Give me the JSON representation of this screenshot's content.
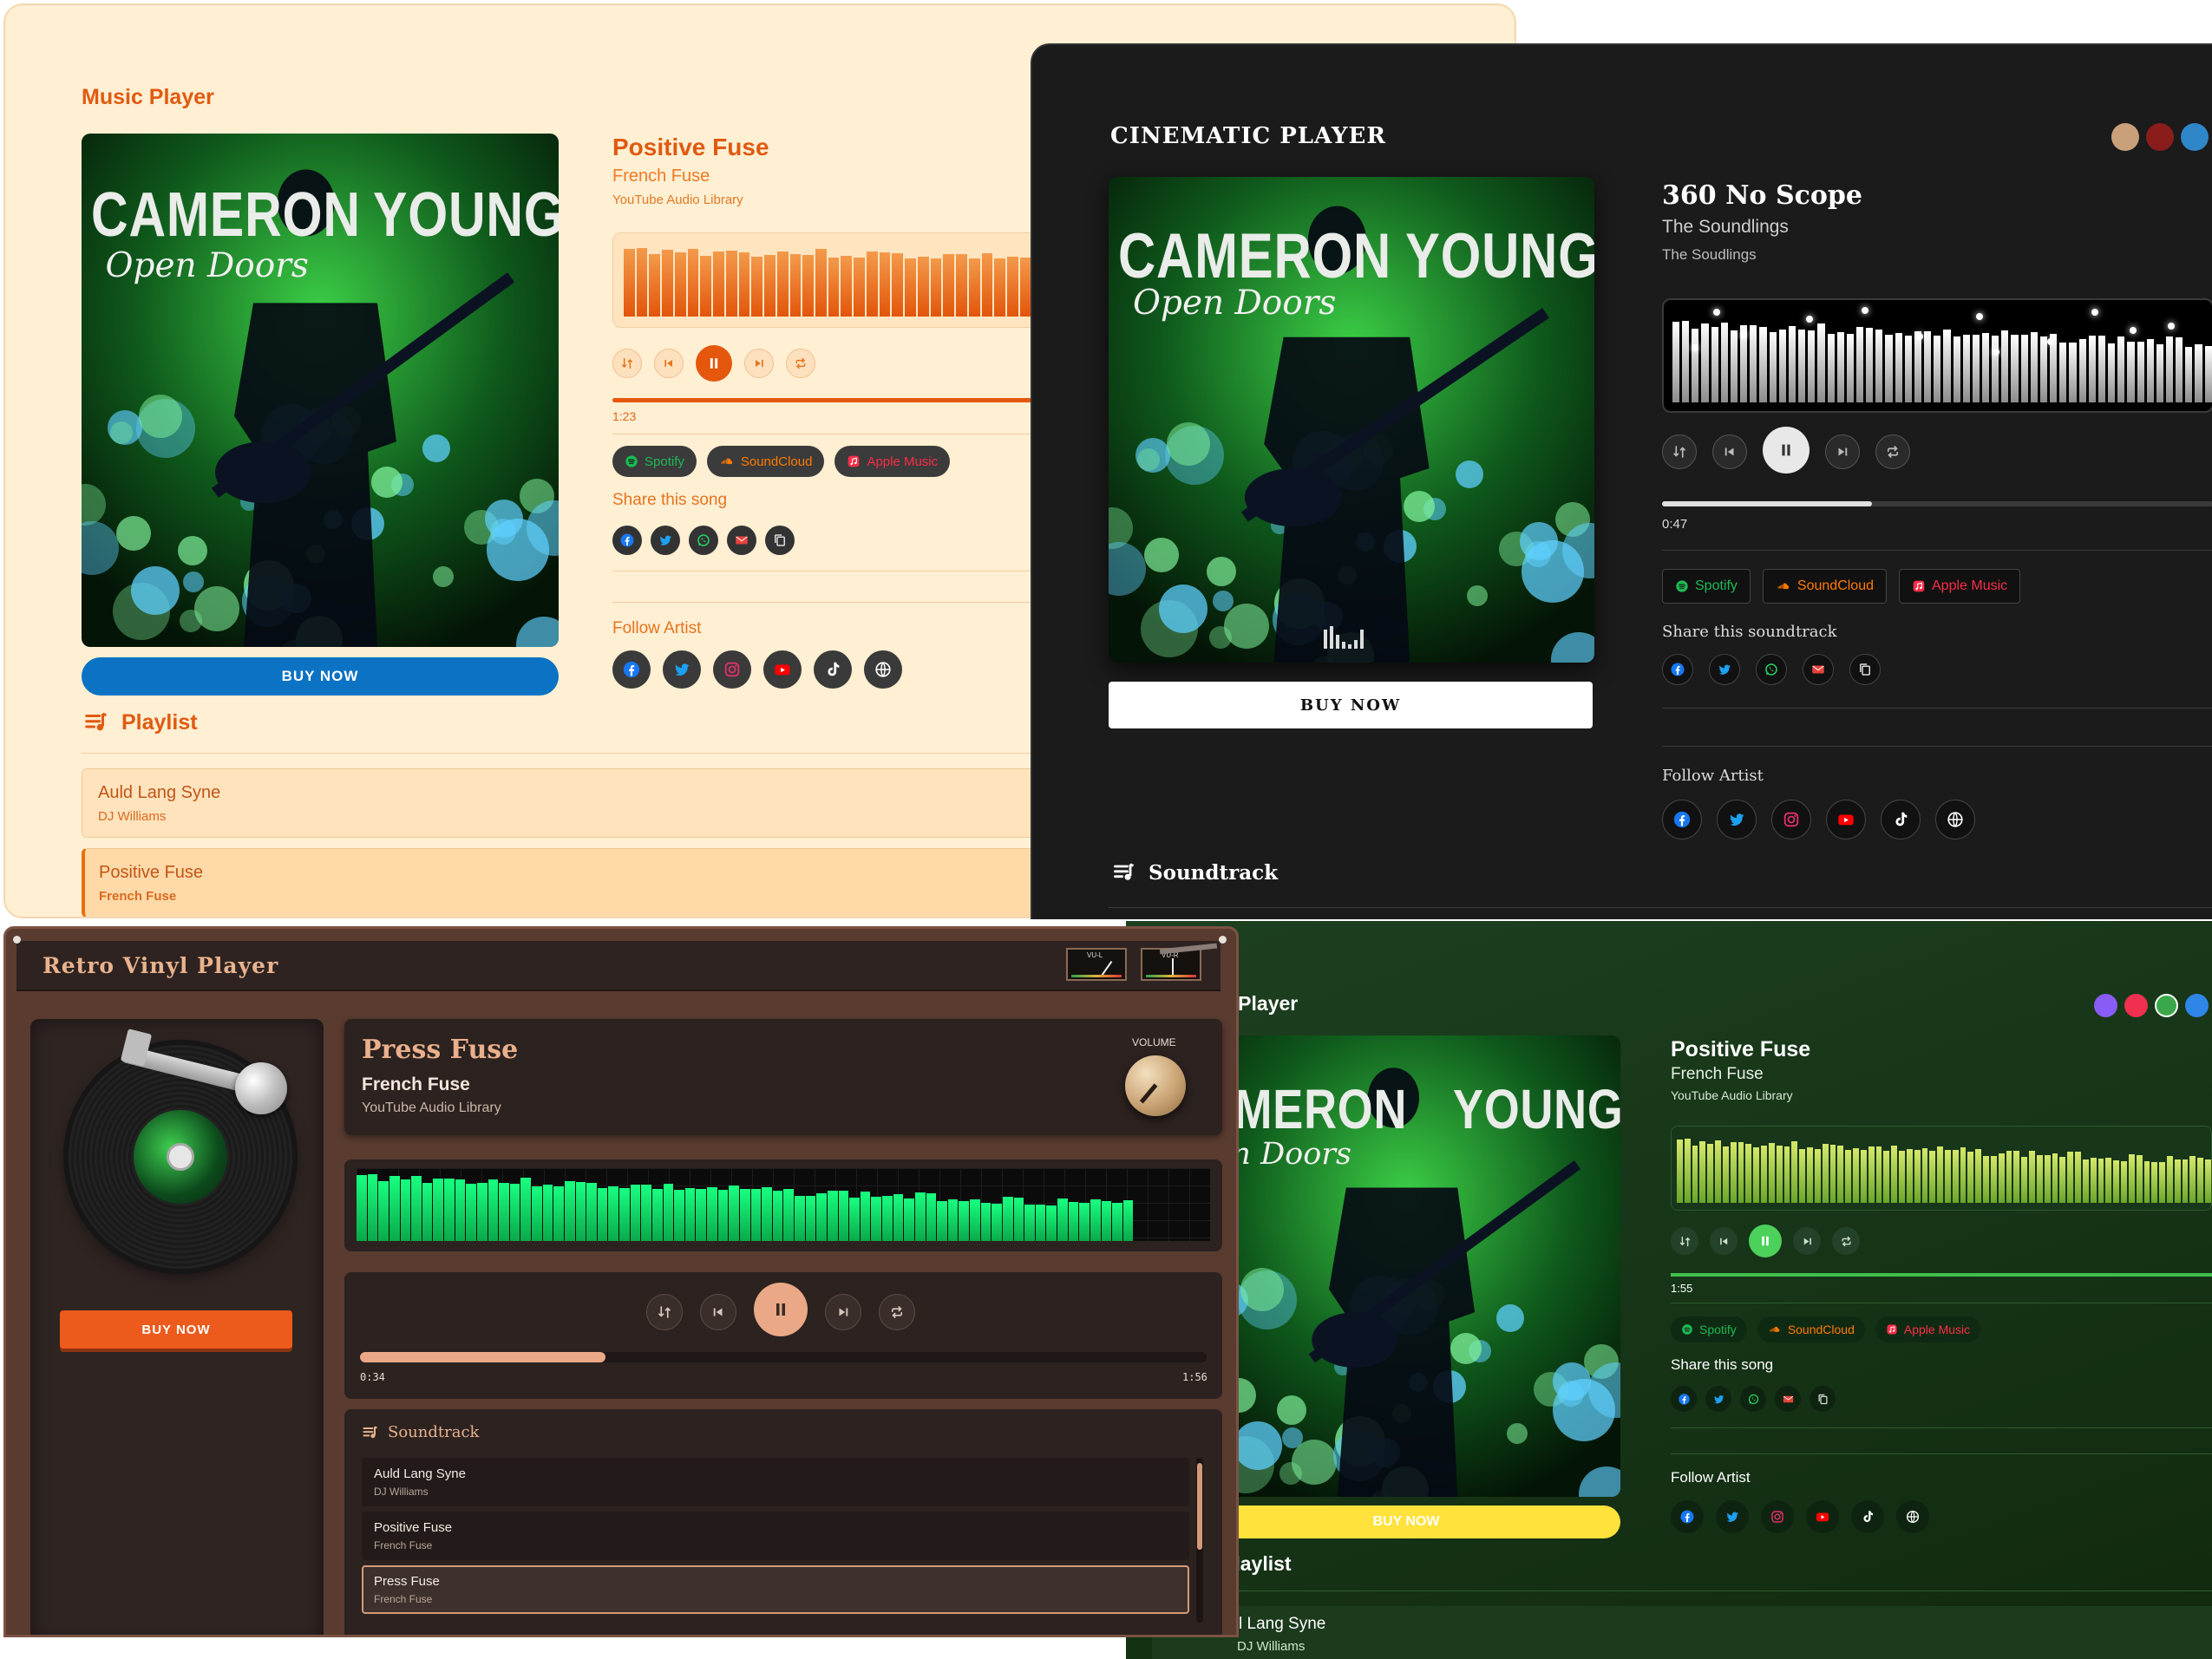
{
  "light_player": {
    "header": "Music Player",
    "title": "Positive Fuse",
    "artist": "French Fuse",
    "source": "YouTube Audio Library",
    "time": "1:23",
    "progress": 0.78,
    "buy_label": "BUY NOW",
    "platforms": [
      "Spotify",
      "SoundCloud",
      "Apple Music"
    ],
    "share_label": "Share this song",
    "follow_label": "Follow Artist",
    "playlist_title": "Playlist",
    "playlist": [
      {
        "title": "Auld Lang Syne",
        "artist": "DJ Williams"
      },
      {
        "title": "Positive Fuse",
        "artist": "French Fuse"
      }
    ],
    "cover": {
      "artist_left": "CAMERON",
      "artist_right": "YOUNG",
      "album": "Open Doors"
    }
  },
  "cinematic_player": {
    "header": "CINEMATIC PLAYER",
    "title": "360 No Scope",
    "artist": "The Soundlings",
    "source": "The Soudlings",
    "time": "0:47",
    "progress": 0.38,
    "buy_label": "BUY NOW",
    "platforms": [
      "Spotify",
      "SoundCloud",
      "Apple Music"
    ],
    "share_label": "Share this soundtrack",
    "follow_label": "Follow Artist",
    "playlist_title": "Soundtrack",
    "theme_dots": [
      "#c9a07a",
      "#8b1c1c",
      "#2f86c9"
    ],
    "cover": {
      "artist_left": "CAMERON",
      "artist_right": "YOUNG",
      "album": "Open Doors"
    }
  },
  "retro_player": {
    "header": "Retro Vinyl Player",
    "vu_left": "VU-L",
    "vu_right": "VU-R",
    "title": "Press Fuse",
    "artist": "French Fuse",
    "source": "YouTube Audio Library",
    "volume_label": "VOLUME",
    "time_current": "0:34",
    "time_total": "1:56",
    "progress": 0.29,
    "buy_label": "BUY NOW",
    "playlist_title": "Soundtrack",
    "playlist": [
      {
        "title": "Auld Lang Syne",
        "artist": "DJ Williams"
      },
      {
        "title": "Positive Fuse",
        "artist": "French Fuse"
      },
      {
        "title": "Press Fuse",
        "artist": "French Fuse"
      }
    ]
  },
  "green_player": {
    "header": "c Player",
    "title": "Positive Fuse",
    "artist": "French Fuse",
    "source": "YouTube Audio Library",
    "time": "1:55",
    "progress": 1.0,
    "buy_label": "BUY NOW",
    "platforms": [
      "Spotify",
      "SoundCloud",
      "Apple Music"
    ],
    "share_label": "Share this song",
    "follow_label": "Follow Artist",
    "playlist_title": "Playlist",
    "playlist": [
      {
        "title": "l Lang Syne",
        "artist": "DJ Williams"
      }
    ],
    "theme_dots": [
      "#8a5cf6",
      "#f0304f",
      "#3aa84a",
      "#2f86e9"
    ],
    "cover": {
      "artist_left": "AMERON",
      "artist_right": "YOUNG",
      "album": "en Doors"
    }
  },
  "colors": {
    "light_accent": "#e85d10",
    "light_bg": "#fff0d4",
    "blue_button": "#0b72c4",
    "cine_bg": "#1b1b1b",
    "retro_bg": "#3c2a24",
    "retro_accent": "#e8a47c",
    "green_bg": "#16341a",
    "green_accent": "#4cd15a",
    "spotify": "#1db954",
    "soundcloud": "#ff7a00",
    "apple_music": "#fa2d48"
  },
  "icons": [
    "shuffle-icon",
    "previous-icon",
    "pause-icon",
    "next-icon",
    "repeat-icon",
    "facebook-icon",
    "twitter-icon",
    "whatsapp-icon",
    "email-icon",
    "copy-icon",
    "instagram-icon",
    "youtube-icon",
    "tiktok-icon",
    "globe-icon",
    "playlist-icon"
  ]
}
